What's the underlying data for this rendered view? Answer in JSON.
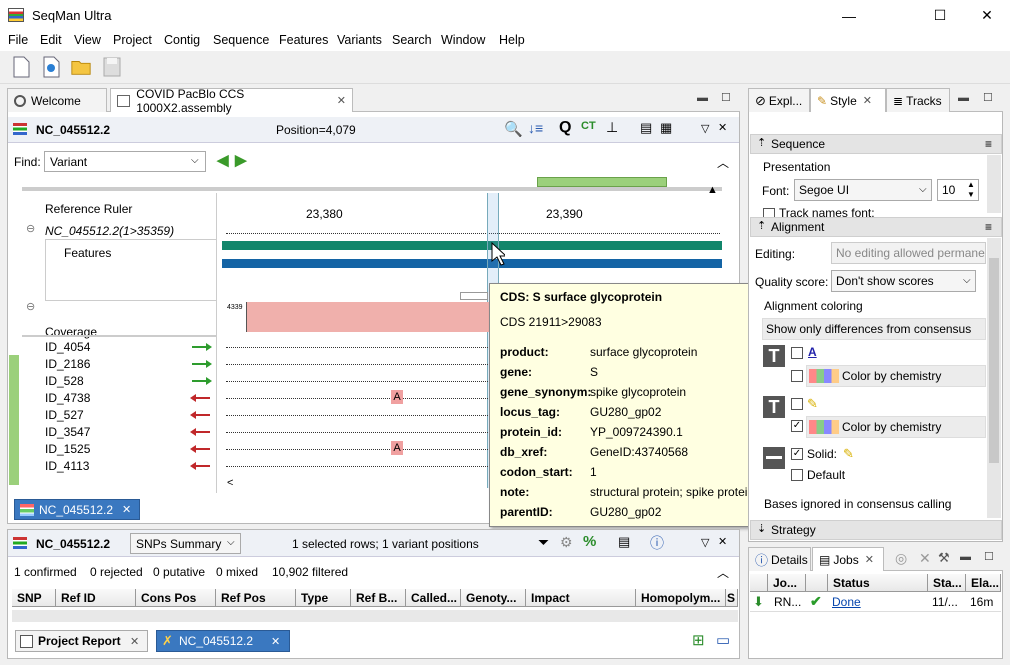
{
  "window": {
    "title": "SeqMan Ultra",
    "minimize": "—",
    "maximize": "☐",
    "close": "✕"
  },
  "menu": [
    "File",
    "Edit",
    "View",
    "Project",
    "Contig",
    "Sequence",
    "Features",
    "Variants",
    "Search",
    "Window",
    "Help"
  ],
  "editor_tabs": {
    "welcome": "Welcome",
    "assembly": "COVID PacBlo CCS 1000X2.assembly"
  },
  "contig_header": {
    "name": "NC_045512.2",
    "position": "Position=4,079"
  },
  "find": {
    "label": "Find:",
    "value": "Variant"
  },
  "ruler": {
    "label": "Reference Ruler",
    "tick1": "23,380",
    "tick2": "23,390"
  },
  "reference": {
    "name": "NC_045512.2(1>35359)",
    "features_label": "Features",
    "coverage_label": "Coverage",
    "coverage_value": "4339"
  },
  "reads": [
    {
      "id": "ID_4054",
      "dir": "fwd"
    },
    {
      "id": "ID_2186",
      "dir": "fwd"
    },
    {
      "id": "ID_528",
      "dir": "fwd"
    },
    {
      "id": "ID_4738",
      "dir": "rev"
    },
    {
      "id": "ID_527",
      "dir": "rev"
    },
    {
      "id": "ID_3547",
      "dir": "rev"
    },
    {
      "id": "ID_1525",
      "dir": "rev"
    },
    {
      "id": "ID_4113",
      "dir": "rev"
    }
  ],
  "base_variant": "A",
  "contig_tab": "NC_045512.2",
  "tooltip": {
    "title": "CDS: S   surface glycoprotein",
    "range": "CDS  21911>29083",
    "fields": [
      {
        "key": "product:",
        "value": "surface glycoprotein"
      },
      {
        "key": "gene:",
        "value": "S"
      },
      {
        "key": "gene_synonym:",
        "value": "spike glycoprotein"
      },
      {
        "key": "locus_tag:",
        "value": "GU280_gp02"
      },
      {
        "key": "protein_id:",
        "value": "YP_009724390.1"
      },
      {
        "key": "db_xref:",
        "value": "GeneID:43740568"
      },
      {
        "key": "codon_start:",
        "value": "1"
      },
      {
        "key": "note:",
        "value": "structural protein; spike protein"
      },
      {
        "key": "parentID:",
        "value": "GU280_gp02"
      }
    ]
  },
  "snp_panel": {
    "name": "NC_045512.2",
    "view": "SNPs Summary",
    "selection": "1 selected rows; 1 variant positions",
    "stats": {
      "confirmed": "1 confirmed",
      "rejected": "0 rejected",
      "putative": "0 putative",
      "mixed": "0 mixed",
      "filtered": "10,902 filtered"
    },
    "columns": [
      "SNP",
      "Ref ID",
      "Cons Pos",
      "Ref Pos",
      "Type",
      "Ref B...",
      "Called...",
      "Genoty...",
      "Impact",
      "Homopolym...",
      "S"
    ]
  },
  "bottom_tabs": {
    "project_report": "Project Report",
    "contig": "NC_045512.2"
  },
  "right_panel": {
    "tabs": {
      "explorer": "Expl...",
      "style": "Style",
      "tracks": "Tracks"
    },
    "sequence_section": "Sequence",
    "presentation": "Presentation",
    "font_label": "Font:",
    "font_value": "Segoe UI",
    "font_size": "10",
    "track_names_font": "Track names font:",
    "alignment_section": "Alignment",
    "editing_label": "Editing:",
    "editing_value": "No editing allowed permane",
    "quality_label": "Quality score:",
    "quality_value": "Don't show scores",
    "alignment_coloring": "Alignment coloring",
    "show_diffs": "Show only differences from consensus",
    "color_chem1": "Color by chemistry",
    "color_chem2": "Color by chemistry",
    "solid": "Solid:",
    "default": "Default",
    "bases_ignored": "Bases ignored in consensus calling",
    "strategy_section": "Strategy"
  },
  "jobs_panel": {
    "tabs": {
      "details": "Details",
      "jobs": "Jobs"
    },
    "columns": [
      "Jo...",
      "Status",
      "Sta...",
      "Ela..."
    ],
    "row": {
      "job": "RN...",
      "status": "Done",
      "start": "11/...",
      "elapsed": "16m"
    }
  },
  "colors": {
    "feature_green": "#12866b",
    "feature_blue": "#1464a5",
    "coverage_pink": "#f0b0ac",
    "tooltip_bg": "#ffffe1",
    "link": "#0645ad"
  }
}
